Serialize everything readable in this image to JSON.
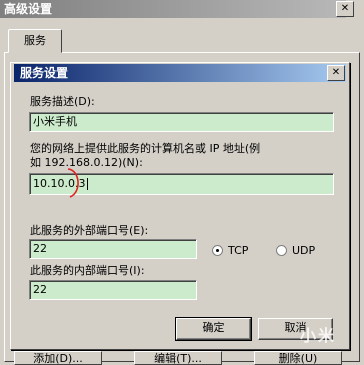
{
  "outer_window": {
    "title": "高级设置",
    "tab_label": "服务",
    "bottom_buttons": [
      "添加(D)...",
      "编辑(T)...",
      "删除(U)"
    ]
  },
  "dialog": {
    "title": "服务设置",
    "description_label": "服务描述(D):",
    "description_value": "小米手机",
    "host_label_line1": "您的网络上提供此服务的计算机名或 IP 地址(例",
    "host_label_line2": "如 192.168.0.12)(N):",
    "host_value": "10.10.0.3",
    "external_port_label": "此服务的外部端口号(E):",
    "external_port_value": "22",
    "internal_port_label": "此服务的内部端口号(I):",
    "internal_port_value": "22",
    "protocol_options": [
      {
        "label": "TCP",
        "selected": true
      },
      {
        "label": "UDP",
        "selected": false
      }
    ],
    "ok_label": "确定",
    "cancel_label": "取消"
  },
  "watermark_text": "小米",
  "annotation_color": "#e02020"
}
